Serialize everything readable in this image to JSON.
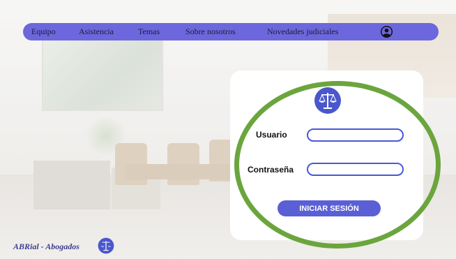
{
  "nav": {
    "items": [
      {
        "label": "Equipo"
      },
      {
        "label": "Asistencia"
      },
      {
        "label": "Temas"
      },
      {
        "label": "Sobre nosotros"
      },
      {
        "label": "Novedades judiciales"
      }
    ],
    "account_icon": "user-circle-icon"
  },
  "login": {
    "logo_icon": "scales-of-justice-icon",
    "username_label": "Usuario",
    "username_value": "",
    "password_label": "Contraseña",
    "password_value": "",
    "submit_label": "INICIAR SESIÓN"
  },
  "footer": {
    "brand": "ABRial - Abogados",
    "logo_icon": "scales-of-justice-icon"
  },
  "colors": {
    "nav_bg": "#6c67dc",
    "button_bg": "#5b5fd6",
    "input_border": "#4b57d6",
    "highlight": "#6ba53d",
    "brand_text": "#3d3f8f"
  }
}
